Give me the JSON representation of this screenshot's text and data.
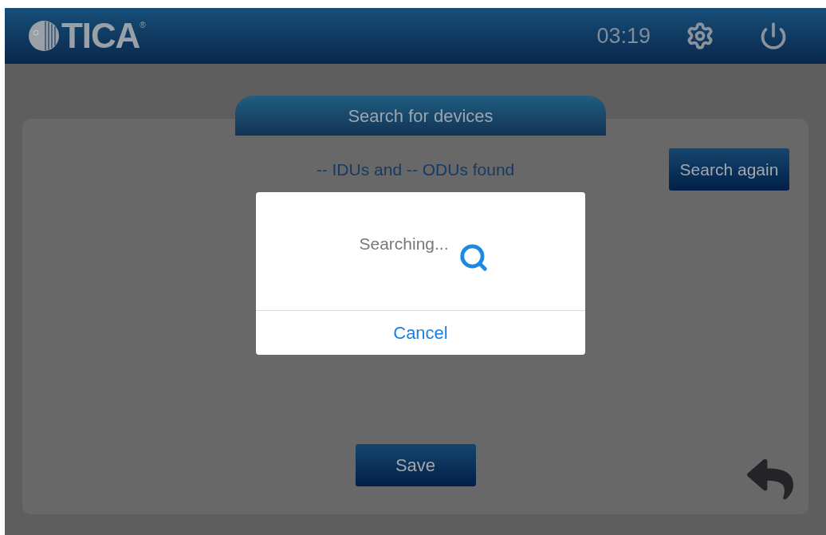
{
  "header": {
    "logo": {
      "text": "TICA",
      "mark": "®"
    },
    "time": "03:19"
  },
  "page": {
    "title": "Search for devices",
    "status": "-- IDUs and -- ODUs found",
    "search_again": "Search again",
    "save": "Save"
  },
  "dialog": {
    "message": "Searching...",
    "cancel": "Cancel"
  }
}
